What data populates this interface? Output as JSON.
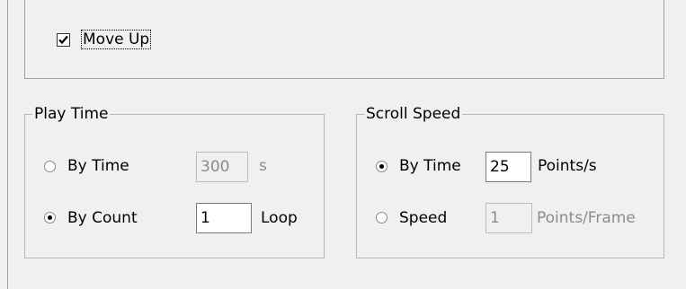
{
  "move_up": {
    "label": "Move Up",
    "checked": true
  },
  "play_time": {
    "title": "Play Time",
    "by_time": {
      "label": "By Time",
      "value": "300",
      "unit": "s",
      "selected": false
    },
    "by_count": {
      "label": "By Count",
      "value": "1",
      "unit": "Loop",
      "selected": true
    }
  },
  "scroll_speed": {
    "title": "Scroll Speed",
    "by_time": {
      "label": "By Time",
      "value": "25",
      "unit": "Points/s",
      "selected": true
    },
    "speed": {
      "label": "Speed",
      "value": "1",
      "unit": "Points/Frame",
      "selected": false
    }
  }
}
